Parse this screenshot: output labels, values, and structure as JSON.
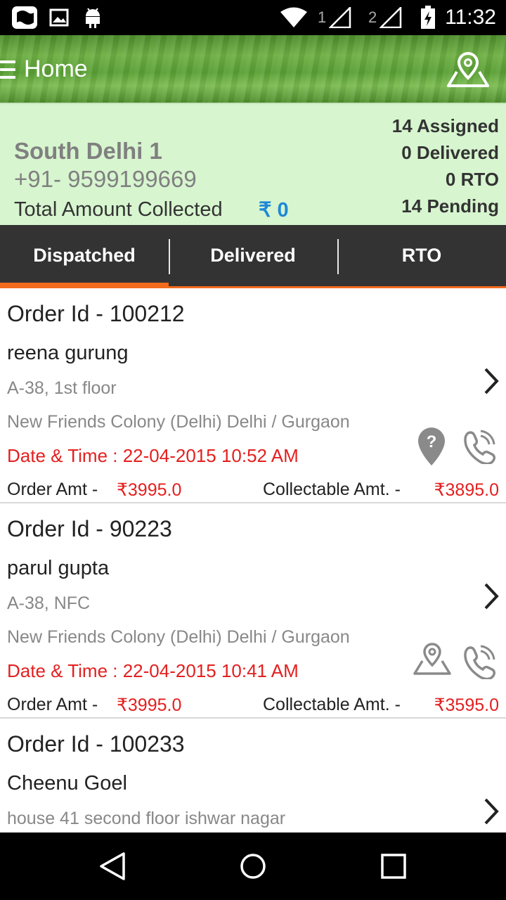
{
  "status_bar": {
    "time": "11:32",
    "sim1": "1",
    "sim2": "2",
    "icons": [
      "notification-icon",
      "gallery-icon",
      "android-icon",
      "wifi-icon",
      "signal-icon",
      "battery-icon"
    ]
  },
  "app_bar": {
    "title": "Home",
    "icons": [
      "menu-icon",
      "map-pin-icon"
    ]
  },
  "summary": {
    "agent_name": "South Delhi 1",
    "phone": "+91- 9599199669",
    "total_label": "Total Amount Collected",
    "total_value": "₹ 0",
    "stats": {
      "assigned": "14 Assigned",
      "delivered": "0 Delivered",
      "rto": "0 RTO",
      "pending": "14 Pending"
    }
  },
  "tabs": [
    {
      "label": "Dispatched",
      "active": true
    },
    {
      "label": "Delivered",
      "active": false
    },
    {
      "label": "RTO",
      "active": false
    }
  ],
  "orders": [
    {
      "id": "Order Id - 100212",
      "name": "reena gurung",
      "addr1": "A-38, 1st floor",
      "addr2": "New Friends Colony (Delhi) Delhi / Gurgaon",
      "date": "Date & Time : 22-04-2015 10:52 AM",
      "amt_label": "Order Amt -",
      "amt_value": "₹3995.0",
      "col_label": "Collectable Amt. -",
      "col_value": "₹3895.0",
      "location_icon": "location-unknown-icon"
    },
    {
      "id": "Order Id - 90223",
      "name": "parul gupta",
      "addr1": "A-38, NFC",
      "addr2": "New Friends Colony (Delhi) Delhi / Gurgaon",
      "date": "Date & Time : 22-04-2015 10:41 AM",
      "amt_label": "Order Amt -",
      "amt_value": "₹3995.0",
      "col_label": "Collectable Amt. -",
      "col_value": "₹3595.0",
      "location_icon": "map-pin-icon"
    },
    {
      "id": "Order Id - 100233",
      "name": "Cheenu Goel",
      "addr1": "house 41 second floor ishwar nagar"
    }
  ],
  "colors": {
    "accent": "#f26b1d",
    "summary_bg": "#d7f5cf",
    "tab_bg": "#333333",
    "amount_red": "#e41f1f",
    "total_blue": "#1e88d6"
  },
  "nav_bar": {
    "icons": [
      "back-icon",
      "home-icon",
      "recents-icon"
    ]
  }
}
